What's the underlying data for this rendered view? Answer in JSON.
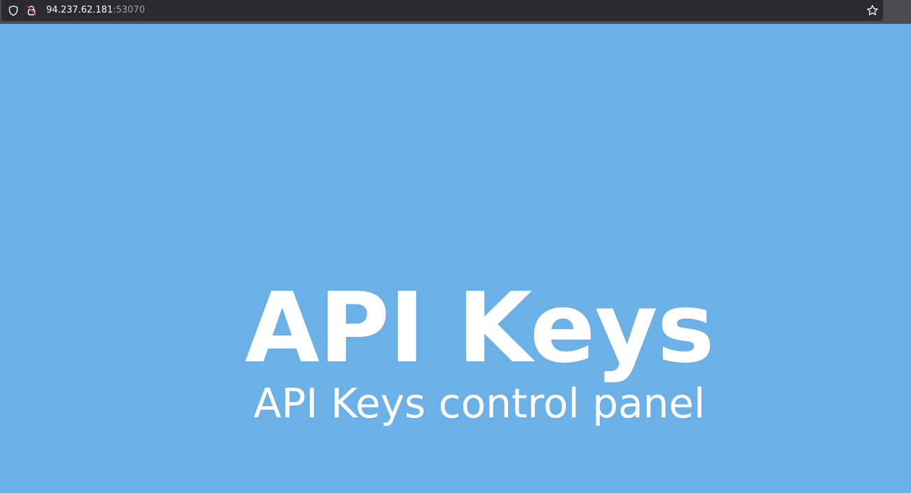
{
  "browser": {
    "url_host": "94.237.62.181",
    "url_port": ":53070",
    "icons": {
      "tracking_protection": "shield-icon",
      "connection_security": "insecure-lock-icon",
      "bookmark": "star-icon"
    }
  },
  "page": {
    "title": "API Keys",
    "subtitle": "API Keys control panel",
    "background_color": "#6cb0e8",
    "text_color": "#ffffff"
  }
}
